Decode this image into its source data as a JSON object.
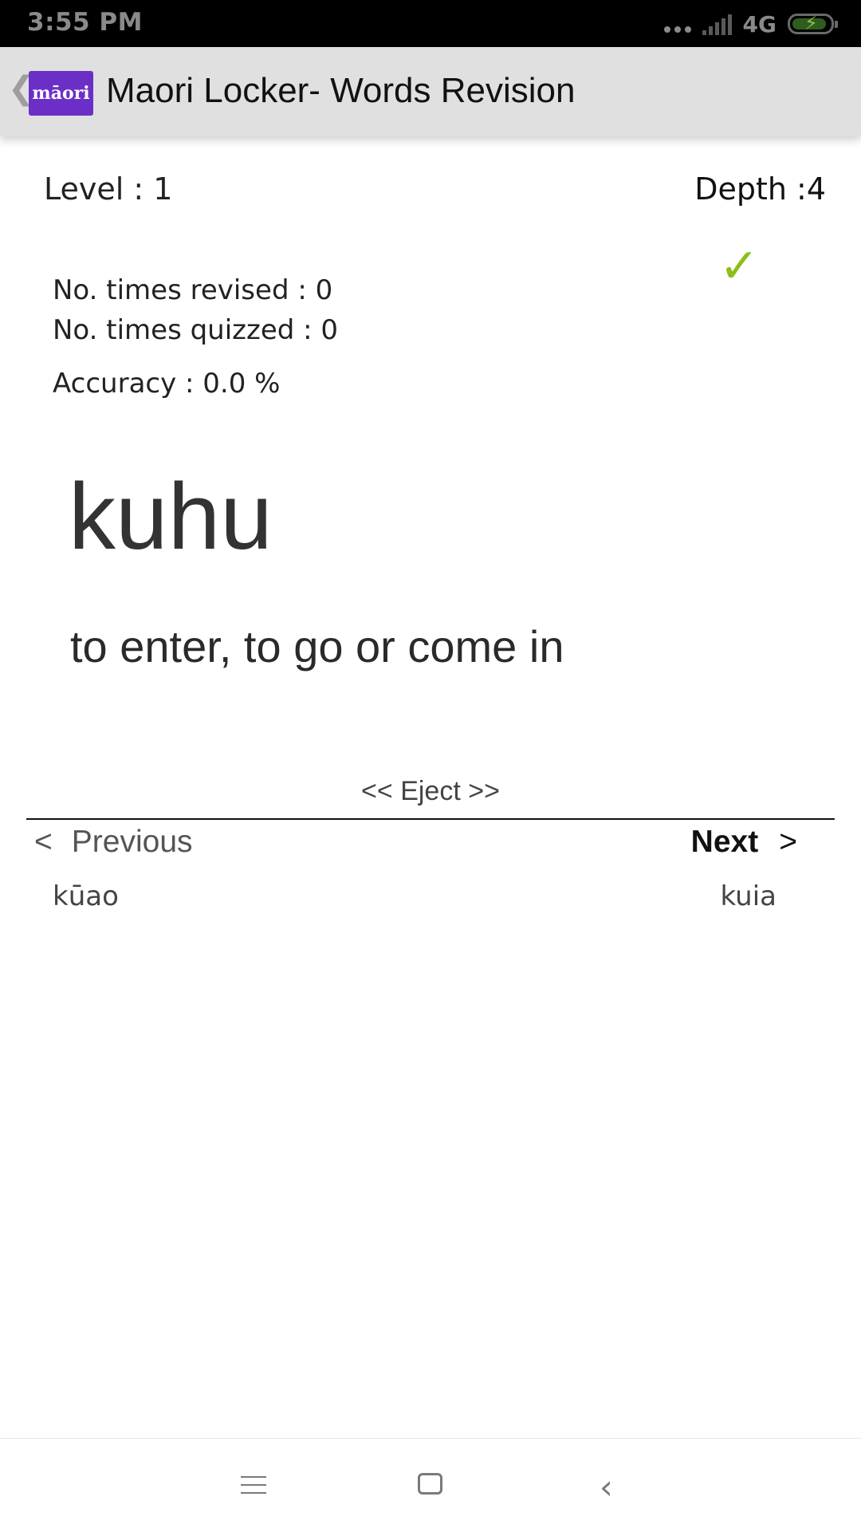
{
  "status_bar": {
    "time": "3:55 PM",
    "network": "4G",
    "icons": [
      "more-dots-icon",
      "signal-icon",
      "battery-charging-icon"
    ]
  },
  "app_bar": {
    "back_icon": "chevron-left-icon",
    "logo_text": "māori",
    "title": "Maori Locker- Words Revision",
    "logo_color": "#6b2fc8"
  },
  "word_card": {
    "level": "Level : 1",
    "depth": "Depth :4",
    "check_icon": "checkmark-icon",
    "check_color": "#8cbf1a",
    "times_revised": "No. times revised : 0",
    "times_quizzed": "No. times quizzed : 0",
    "accuracy": "Accuracy : 0.0 %",
    "word": "kuhu",
    "meaning": "to enter, to go or come in"
  },
  "navigation": {
    "eject_label": "<< Eject >>",
    "prev_arrow": "<",
    "prev_label": "Previous",
    "prev_word": "kūao",
    "next_label": "Next",
    "next_arrow": ">",
    "next_word": "kuia"
  },
  "system_nav": {
    "icons": [
      "menu-icon",
      "home-icon",
      "back-icon"
    ]
  }
}
